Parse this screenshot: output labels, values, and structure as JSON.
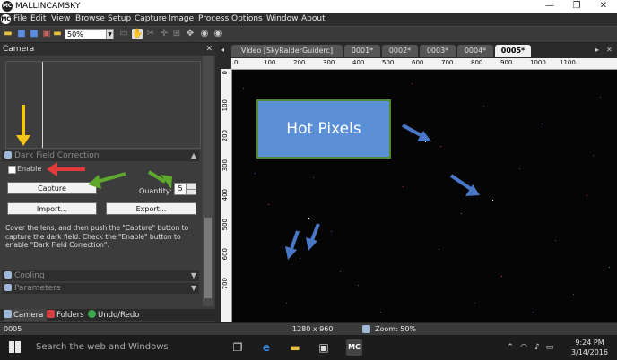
{
  "window": {
    "logo": "MC",
    "title": "MALLINCAMSKY",
    "minimize": "—",
    "maximize": "❐",
    "close": "✕"
  },
  "menubar": {
    "sys_logo": "MC",
    "items": [
      "File",
      "Edit",
      "View",
      "Browse",
      "Setup",
      "Capture",
      "Image",
      "Process",
      "Options",
      "Window",
      "About"
    ]
  },
  "toolbar": {
    "zoom_value": "50%"
  },
  "left_panel": {
    "title": "Camera",
    "close_glyph": "✕",
    "dark_field_section": "Dark Field Correction",
    "enable_label": "Enable",
    "capture_button": "Capture",
    "quantity_label": "Quantity:",
    "quantity_value": "5",
    "import_button": "Import...",
    "export_button": "Export...",
    "help_text": "Cover the lens, and then push the \"Capture\" button to capture the dark field. Check the \"Enable\" button to enable \"Dark Field Correction\".",
    "cooling_section": "Cooling",
    "parameters_section": "Parameters",
    "bottom_tabs": [
      "Camera",
      "Folders",
      "Undo/Redo"
    ]
  },
  "document_tabs": [
    "Video [SkyRaiderGuiderc]",
    "0001*",
    "0002*",
    "0003*",
    "0004*",
    "0005*"
  ],
  "rulers": {
    "top_labels": [
      "0",
      "100",
      "200",
      "300",
      "400",
      "500",
      "600",
      "700",
      "800",
      "900",
      "1000",
      "1100"
    ],
    "left_labels": [
      "0",
      "100",
      "200",
      "300",
      "400",
      "500",
      "600",
      "700"
    ]
  },
  "image": {
    "annotation_text": "Hot Pixels"
  },
  "statusbar": {
    "frame": "0005",
    "resolution": "1280 x 960",
    "zoom": "Zoom: 50%"
  },
  "taskbar": {
    "search_placeholder": "Search the web and Windows",
    "app_mc": "MC",
    "time": "9:24 PM",
    "date": "3/14/2016"
  },
  "colors": {
    "annotation_box": "#5b8fd6",
    "annotation_border": "#4e8c2f",
    "arrow_yellow": "#f5c518",
    "arrow_red": "#e23b3b",
    "arrow_green": "#5fa82e",
    "arrow_blue": "#4a78c8"
  }
}
